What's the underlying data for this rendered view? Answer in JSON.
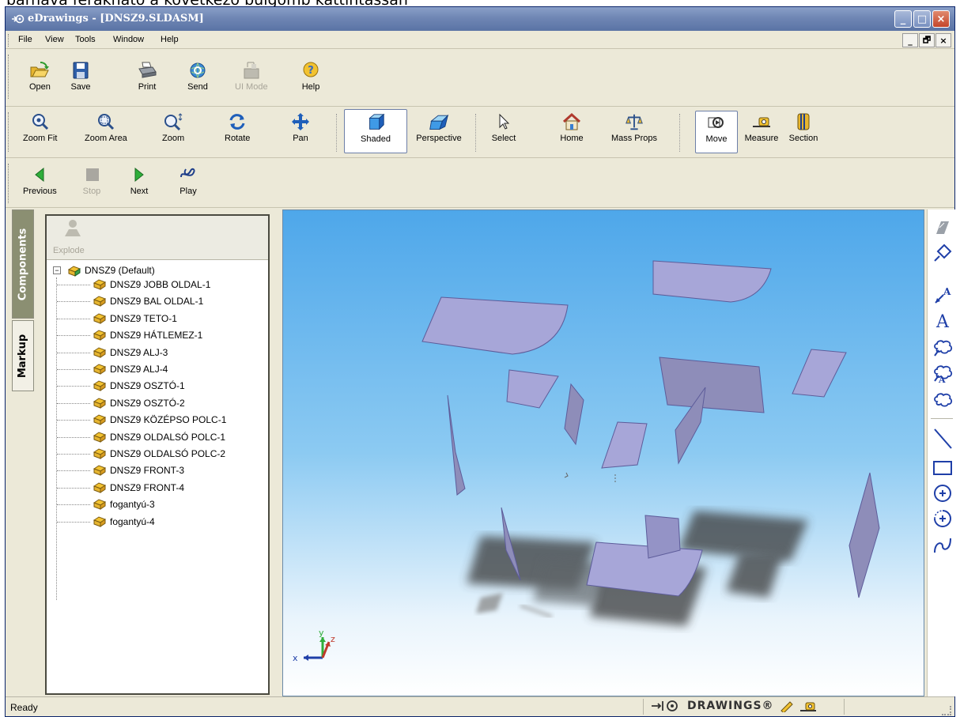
{
  "top_caption": "barnává ferakhato a kovetkezo bulgomb kattintassan",
  "window": {
    "title": "eDrawings - [DNSZ9.SLDASM]",
    "controls": [
      "_",
      "□",
      "×"
    ]
  },
  "menubar": {
    "items": [
      "File",
      "View",
      "Tools",
      "Window",
      "Help"
    ],
    "mdi_controls": [
      "_",
      "🗗",
      "×"
    ]
  },
  "toolbar1": {
    "buttons": [
      {
        "label": "Open",
        "icon": "open-folder-icon"
      },
      {
        "label": "Save",
        "icon": "floppy-save-icon"
      },
      {
        "label": "Print",
        "icon": "printer-icon"
      },
      {
        "label": "Send",
        "icon": "send-globe-icon"
      },
      {
        "label": "UI Mode",
        "icon": "ui-mode-icon"
      },
      {
        "label": "Help",
        "icon": "help-icon"
      }
    ]
  },
  "toolbar2": {
    "buttons": [
      {
        "label": "Zoom Fit",
        "icon": "zoom-fit-icon"
      },
      {
        "label": "Zoom Area",
        "icon": "zoom-area-icon"
      },
      {
        "label": "Zoom",
        "icon": "zoom-icon"
      },
      {
        "label": "Rotate",
        "icon": "rotate-icon"
      },
      {
        "label": "Pan",
        "icon": "pan-icon"
      },
      {
        "label": "Shaded",
        "icon": "shaded-cube-icon"
      },
      {
        "label": "Perspective",
        "icon": "perspective-icon"
      },
      {
        "label": "Select",
        "icon": "select-arrow-icon"
      },
      {
        "label": "Home",
        "icon": "home-icon"
      },
      {
        "label": "Mass Props",
        "icon": "mass-props-icon"
      },
      {
        "label": "Move",
        "icon": "move-icon"
      },
      {
        "label": "Measure",
        "icon": "measure-icon"
      },
      {
        "label": "Section",
        "icon": "section-icon"
      }
    ]
  },
  "toolbar3": {
    "buttons": [
      {
        "label": "Previous",
        "icon": "previous-arrow-icon"
      },
      {
        "label": "Stop",
        "icon": "stop-icon"
      },
      {
        "label": "Next",
        "icon": "next-arrow-icon"
      },
      {
        "label": "Play",
        "icon": "play-icon"
      }
    ]
  },
  "side_tabs": [
    "Components",
    "Markup"
  ],
  "tree": {
    "explode_label": "Explode",
    "root": "DNSZ9 (Default)",
    "items": [
      "DNSZ9 JOBB OLDAL-1",
      "DNSZ9 BAL OLDAL-1",
      "DNSZ9 TETO-1",
      "DNSZ9 HÁTLEMEZ-1",
      "DNSZ9 ALJ-3",
      "DNSZ9 ALJ-4",
      "DNSZ9 OSZTÓ-1",
      "DNSZ9 OSZTÓ-2",
      "DNSZ9 KÖZÉPSO POLC-1",
      "DNSZ9 OLDALSÓ POLC-1",
      "DNSZ9 OLDALSÓ POLC-2",
      "DNSZ9 FRONT-3",
      "DNSZ9 FRONT-4",
      "fogantyú-3",
      "fogantyú-4"
    ]
  },
  "viewport": {
    "triad_labels": {
      "x": "x",
      "y": "y",
      "z": "z"
    }
  },
  "markup_tools": [
    "markup-cursor-icon",
    "dimension-icon",
    "leader-text-icon",
    "text-icon",
    "cloud-leader-icon",
    "cloud-text-icon",
    "cloud-icon",
    "line-icon",
    "rectangle-icon",
    "circle-icon",
    "arc-icon",
    "spline-icon"
  ],
  "statusbar": {
    "text": "Ready",
    "brand": "DRAWINGS®"
  },
  "colors": {
    "title_bar": "#6f86b4",
    "panel_face": "#ece9d8",
    "viewport_sky": "#4ea7ea",
    "part_face": "#a7a6d8",
    "part_edge": "#5d5c9a",
    "tab_active": "#8b8f72",
    "markup_blue": "#1f3fa8"
  }
}
